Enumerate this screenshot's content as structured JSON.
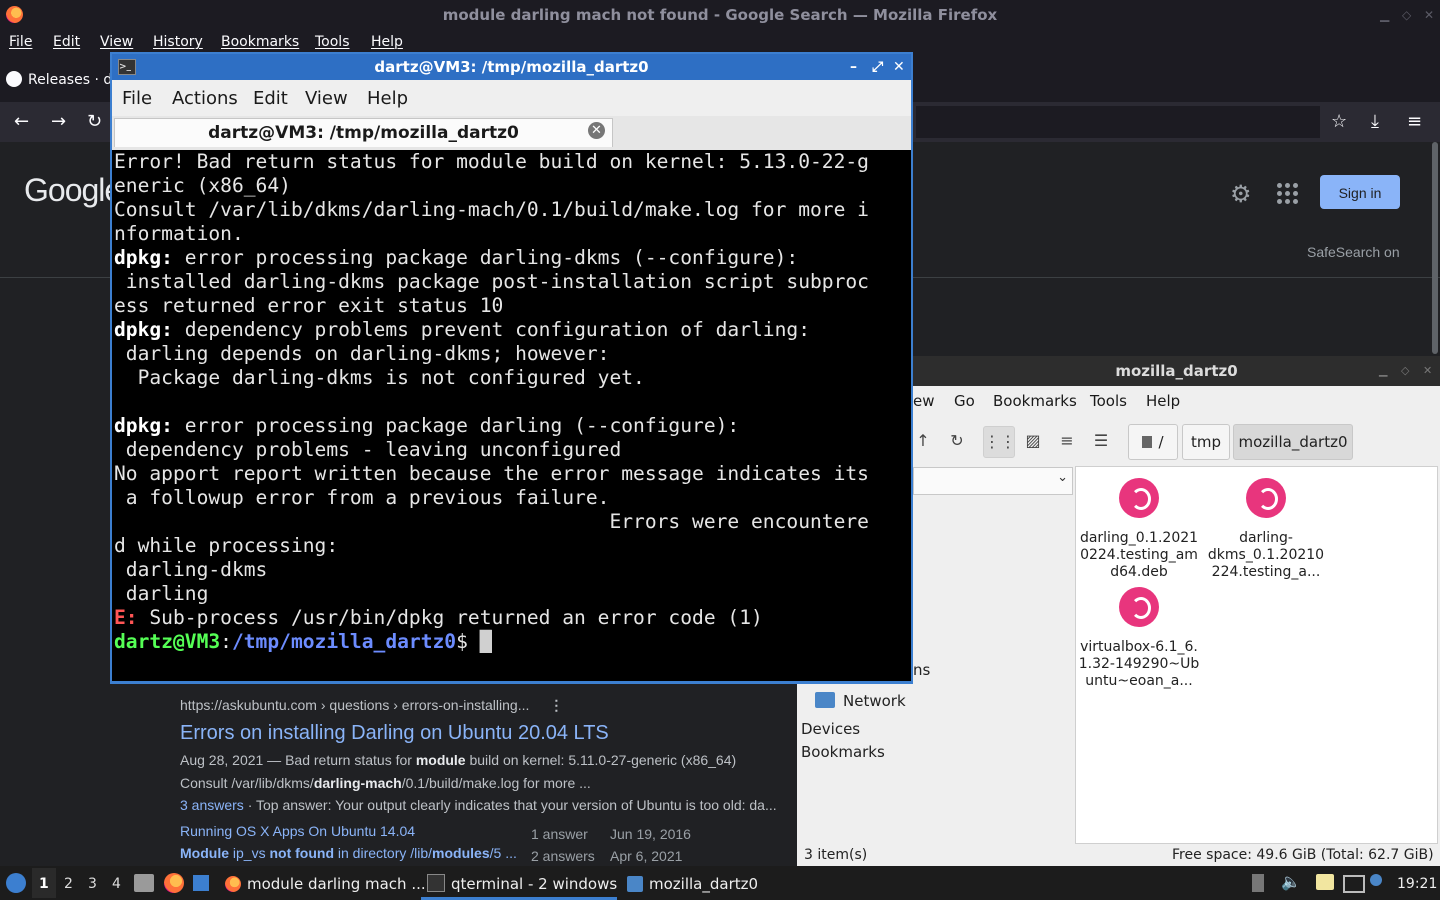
{
  "firefox": {
    "window_title": "module darling mach not found - Google Search — Mozilla Firefox",
    "menu": [
      "File",
      "Edit",
      "View",
      "History",
      "Bookmarks",
      "Tools",
      "Help"
    ],
    "tab_label": "Releases · d",
    "google": {
      "logo_text": "Google",
      "sign_in": "Sign in",
      "safesearch": "SafeSearch on"
    },
    "result": {
      "url": "https://askubuntu.com › questions › errors-on-installing...",
      "more": "⋮",
      "title": "Errors on installing Darling on Ubuntu 20.04 LTS",
      "snippet1_pre": "Aug 28, 2021 — Bad return status for ",
      "snippet1_bold": "module",
      "snippet1_post": " build on kernel: 5.11.0-27-generic (x86_64)",
      "snippet2_pre": "Consult /var/lib/dkms/",
      "snippet2_bold": "darling-mach",
      "snippet2_post": "/0.1/build/make.log for more ...",
      "answers_link": "3 answers",
      "answers_rest": " · Top answer: Your output clearly indicates that your version of Ubuntu is too old: da...",
      "sub": [
        {
          "title_pre": "Running OS X Apps On Ubuntu 14.04",
          "title_bold": "",
          "title_post": "",
          "answers": "1 answer",
          "date": "Jun 19, 2016"
        },
        {
          "title_pre": "",
          "title_bold": "Module",
          "title_post": " ip_vs not found in directory /lib/modules/5 ...",
          "title_bold2": "not found",
          "answers": "2 answers",
          "date": "Apr 6, 2021"
        }
      ]
    }
  },
  "file_manager": {
    "title": "mozilla_dartz0",
    "menu": [
      "ew",
      "Go",
      "Bookmarks",
      "Tools",
      "Help"
    ],
    "breadcrumbs": [
      "/",
      "tmp",
      "mozilla_dartz0"
    ],
    "side": {
      "partial": "ns",
      "network": "Network",
      "devices": "Devices",
      "bookmarks": "Bookmarks"
    },
    "files": [
      {
        "name": "darling_0.1.2021\n0224.testing_am\nd64.deb"
      },
      {
        "name": "darling-\ndkms_0.1.20210\n224.testing_a..."
      },
      {
        "name": "virtualbox-6.1_6.\n1.32-149290~Ub\nuntu~eoan_a..."
      }
    ],
    "status_left": "3 item(s)",
    "status_right": "Free space: 49.6 GiB (Total: 62.7 GiB)"
  },
  "terminal": {
    "title": "dartz@VM3: /tmp/mozilla_dartz0",
    "menu": [
      "File",
      "Actions",
      "Edit",
      "View",
      "Help"
    ],
    "tab_label": "dartz@VM3: /tmp/mozilla_dartz0",
    "lines": {
      "l1": "Error! Bad return status for module build on kernel: 5.13.0-22-g",
      "l2": "eneric (x86_64)",
      "l3": "Consult /var/lib/dkms/darling-mach/0.1/build/make.log for more i",
      "l4": "nformation.",
      "dpkg": "dpkg:",
      "l5": " error processing package darling-dkms (--configure):",
      "l6": " installed darling-dkms package post-installation script subproc",
      "l7": "ess returned error exit status 10",
      "l8": " dependency problems prevent configuration of darling:",
      "l9": " darling depends on darling-dkms; however:",
      "l10": "  Package darling-dkms is not configured yet.",
      "l11": " error processing package darling (--configure):",
      "l12": " dependency problems - leaving unconfigured",
      "l13": "No apport report written because the error message indicates its",
      "l14": " a followup error from a previous failure.",
      "l15": "                                          Errors were encountere",
      "l16": "d while processing:",
      "l17": " darling-dkms",
      "l18": " darling",
      "e": "E:",
      "l19": " Sub-process /usr/bin/dpkg returned an error code (1)",
      "prompt_user": "dartz@VM3",
      "prompt_colon": ":",
      "prompt_path": "/tmp/mozilla_dartz0",
      "prompt_end": "$ "
    }
  },
  "taskbar": {
    "workspaces": [
      "1",
      "2",
      "3",
      "4"
    ],
    "tasks": [
      "module darling mach ...",
      "qterminal - 2 windows",
      "mozilla_dartz0"
    ],
    "clock": "19:21"
  },
  "colors": {
    "terminal_border": "#3c7fd0",
    "google_link": "#8ab4f8",
    "prompt_user": "#55ff55",
    "prompt_path": "#6c8cff",
    "error": "#ff5555"
  }
}
